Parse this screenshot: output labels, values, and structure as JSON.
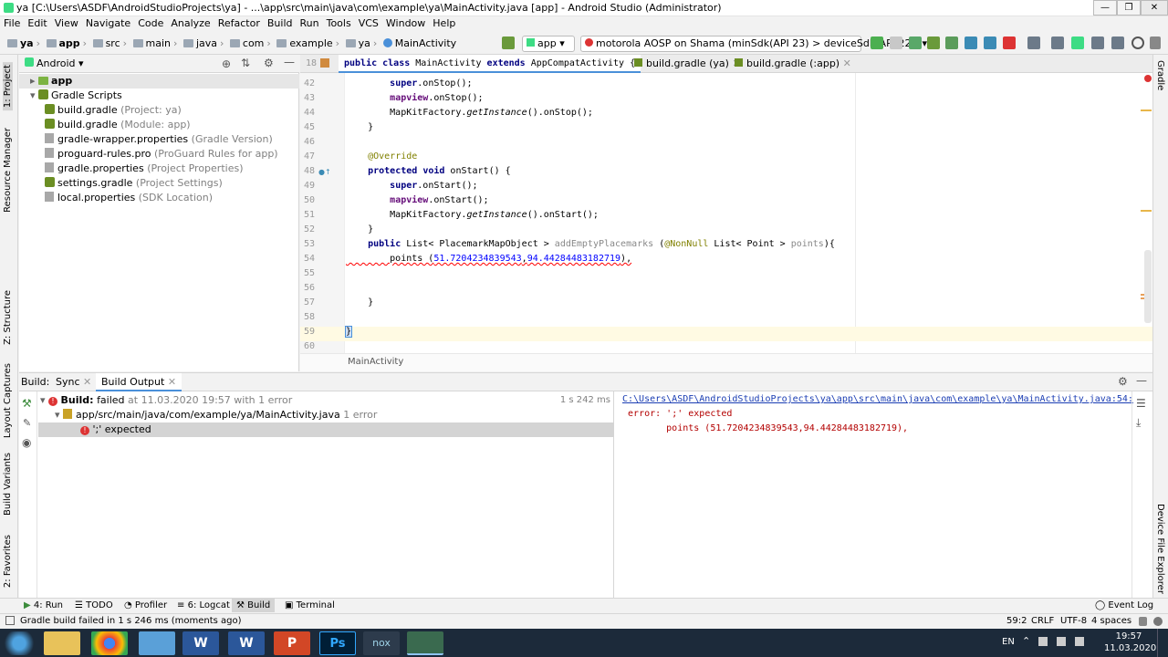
{
  "window": {
    "title": "ya [C:\\Users\\ASDF\\AndroidStudioProjects\\ya] - ...\\app\\src\\main\\java\\com\\example\\ya\\MainActivity.java [app] - Android Studio (Administrator)",
    "minimize": "—",
    "maximize": "❐",
    "close": "✕"
  },
  "menu": [
    "File",
    "Edit",
    "View",
    "Navigate",
    "Code",
    "Analyze",
    "Refactor",
    "Build",
    "Run",
    "Tools",
    "VCS",
    "Window",
    "Help"
  ],
  "breadcrumb": [
    "ya",
    "app",
    "src",
    "main",
    "java",
    "com",
    "example",
    "ya",
    "MainActivity"
  ],
  "toolbar": {
    "run_config": "app",
    "device": "motorola AOSP on Shama (minSdk(API 23) > deviceSdk(API 22))"
  },
  "left_strip": [
    "1: Project",
    "Resource Manager",
    "Z: Structure",
    "Layout Captures",
    "Build Variants",
    "2: Favorites"
  ],
  "right_strip": [
    "Gradle",
    "Device File Explorer"
  ],
  "project": {
    "view": "Android",
    "root": "app",
    "gradle_scripts": "Gradle Scripts",
    "files": [
      {
        "name": "build.gradle",
        "hint": "(Project: ya)"
      },
      {
        "name": "build.gradle",
        "hint": "(Module: app)"
      },
      {
        "name": "gradle-wrapper.properties",
        "hint": "(Gradle Version)"
      },
      {
        "name": "proguard-rules.pro",
        "hint": "(ProGuard Rules for app)"
      },
      {
        "name": "gradle.properties",
        "hint": "(Project Properties)"
      },
      {
        "name": "settings.gradle",
        "hint": "(Project Settings)"
      },
      {
        "name": "local.properties",
        "hint": "(SDK Location)"
      }
    ]
  },
  "editor": {
    "sticky_line": "18",
    "sticky_text": "public class MainActivity extends AppCompatActivity {",
    "tabs": [
      "build.gradle (ya)",
      "build.gradle (:app)"
    ],
    "lines": [
      {
        "n": "42",
        "t": "        super.onStop();"
      },
      {
        "n": "43",
        "t": "        mapview.onStop();"
      },
      {
        "n": "44",
        "t": "        MapKitFactory.getInstance().onStop();"
      },
      {
        "n": "45",
        "t": "    }"
      },
      {
        "n": "46",
        "t": ""
      },
      {
        "n": "47",
        "t": "    @Override"
      },
      {
        "n": "48",
        "t": "    protected void onStart() {"
      },
      {
        "n": "49",
        "t": "        super.onStart();"
      },
      {
        "n": "50",
        "t": "        mapview.onStart();"
      },
      {
        "n": "51",
        "t": "        MapKitFactory.getInstance().onStart();"
      },
      {
        "n": "52",
        "t": "    }"
      },
      {
        "n": "53",
        "t": "    public List< PlacemarkMapObject > addEmptyPlacemarks (@NonNull List< Point > points){"
      },
      {
        "n": "54",
        "t": "        points (51.7204234839543,94.44284483182719),"
      },
      {
        "n": "55",
        "t": ""
      },
      {
        "n": "56",
        "t": ""
      },
      {
        "n": "57",
        "t": "    }"
      },
      {
        "n": "58",
        "t": ""
      },
      {
        "n": "59",
        "t": "}"
      },
      {
        "n": "60",
        "t": ""
      }
    ],
    "footer": "MainActivity"
  },
  "build": {
    "tabs": [
      "Build:",
      "Sync",
      "Build Output"
    ],
    "result_label": "Build:",
    "result_status": "failed",
    "result_detail": "at 11.03.2020 19:57 with 1 error",
    "duration": "1 s 242 ms",
    "file": "app/src/main/java/com/example/ya/MainActivity.java",
    "file_count": "1 error",
    "error": "';' expected",
    "output_link": "C:\\Users\\ASDF\\AndroidStudioProjects\\ya\\app\\src\\main\\java\\com\\example\\ya\\MainActivity.java:54:",
    "output_error": "error: ';' expected",
    "output_code": "        points (51.7204234839543,94.44284483182719),"
  },
  "bottom_tools": [
    "4: Run",
    "TODO",
    "Profiler",
    "6: Logcat",
    "Build",
    "Terminal"
  ],
  "event_log": "Event Log",
  "status": {
    "message": "Gradle build failed in 1 s 246 ms (moments ago)",
    "position": "59:2",
    "line_sep": "CRLF",
    "encoding": "UTF-8",
    "indent": "4 spaces"
  },
  "taskbar": {
    "lang": "EN",
    "time": "19:57",
    "date": "11.03.2020",
    "nox": "nox"
  }
}
